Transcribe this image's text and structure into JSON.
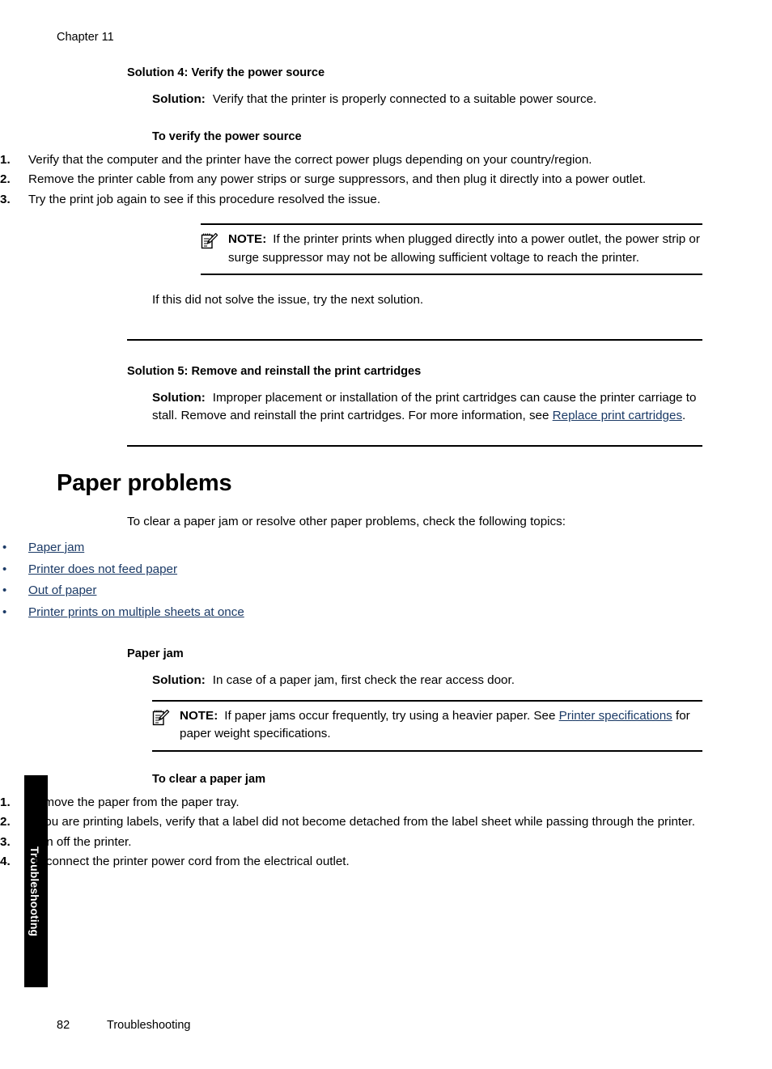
{
  "running_head": "Chapter 11",
  "thumb_tab": {
    "label": "Troubleshooting"
  },
  "footer": {
    "page_number": "82",
    "section": "Troubleshooting"
  },
  "labels": {
    "solution_label": "Solution:",
    "note_label": "NOTE:"
  },
  "solution4": {
    "heading": "Solution 4: Verify the power source",
    "solution_text": "Verify that the printer is properly connected to a suitable power source.",
    "procedure_heading": "To verify the power source",
    "steps": [
      {
        "num": "1.",
        "text": "Verify that the computer and the printer have the correct power plugs depending on your country/region."
      },
      {
        "num": "2.",
        "text": "Remove the printer cable from any power strips or surge suppressors, and then plug it directly into a power outlet."
      },
      {
        "num": "3.",
        "text": "Try the print job again to see if this procedure resolved the issue."
      }
    ],
    "note_text": "If the printer prints when plugged directly into a power outlet, the power strip or surge suppressor may not be allowing sufficient voltage to reach the printer.",
    "closing_text": "If this did not solve the issue, try the next solution."
  },
  "solution5": {
    "heading": "Solution 5: Remove and reinstall the print cartridges",
    "solution_text_before_link": "Improper placement or installation of the print cartridges can cause the printer carriage to stall. Remove and reinstall the print cartridges. For more information, see ",
    "link": "Replace print cartridges",
    "solution_text_after_link": "."
  },
  "paper_problems": {
    "heading": "Paper problems",
    "intro": "To clear a paper jam or resolve other paper problems, check the following topics:",
    "bullet": "•",
    "links": [
      "Paper jam",
      "Printer does not feed paper",
      "Out of paper",
      "Printer prints on multiple sheets at once"
    ]
  },
  "paper_jam": {
    "heading": "Paper jam",
    "solution_text": "In case of a paper jam, first check the rear access door.",
    "note_text_before_link": "If paper jams occur frequently, try using a heavier paper. See ",
    "note_link": "Printer specifications",
    "note_text_after_link": " for paper weight specifications.",
    "procedure_heading": "To clear a paper jam",
    "steps": [
      {
        "num": "1.",
        "text": "Remove the paper from the paper tray."
      },
      {
        "num": "2.",
        "text": "If you are printing labels, verify that a label did not become detached from the label sheet while passing through the printer."
      },
      {
        "num": "3.",
        "text": "Turn off the printer."
      },
      {
        "num": "4.",
        "text": "Disconnect the printer power cord from the electrical outlet."
      }
    ]
  },
  "colors": {
    "link": "#1b3a66",
    "text": "#000000",
    "tab_background": "#000000",
    "tab_text": "#ffffff"
  },
  "icons": {
    "note": "note-pencil-icon"
  }
}
